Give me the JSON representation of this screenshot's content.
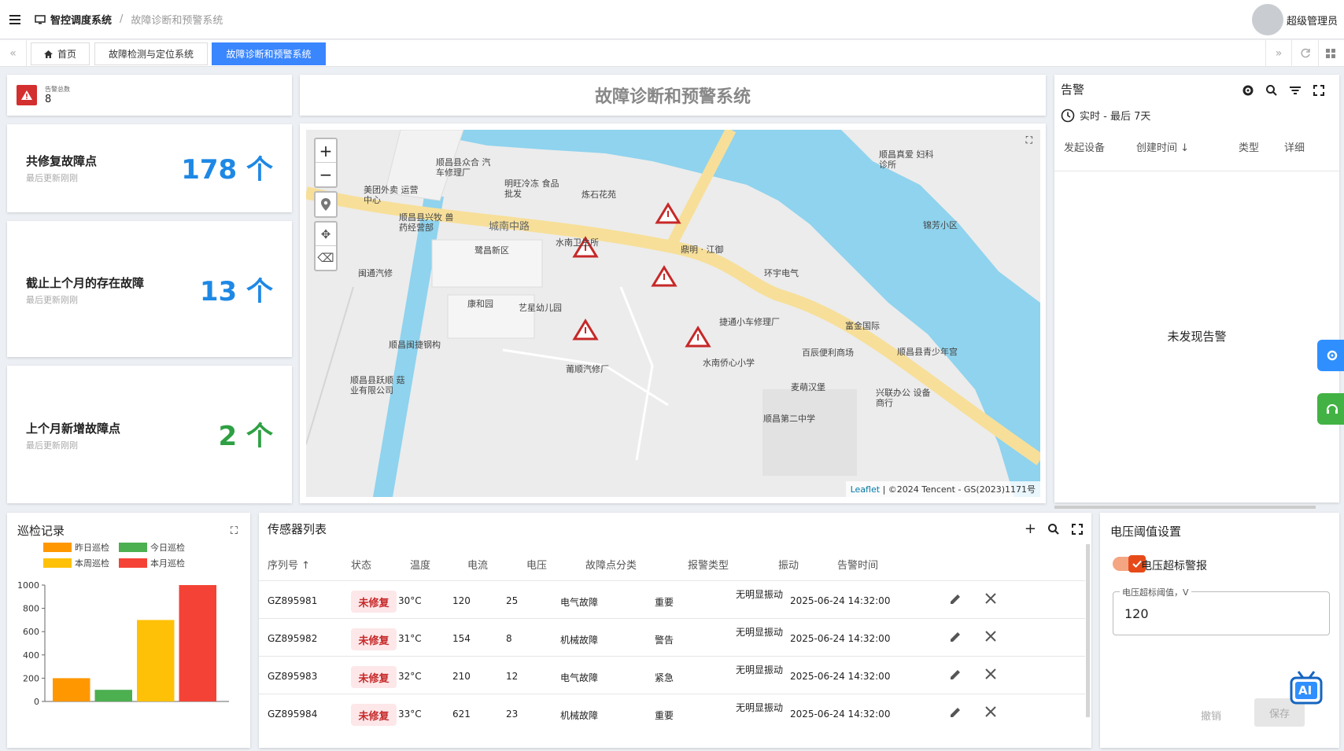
{
  "header": {
    "app_title": "智控调度系统",
    "current_page": "故障诊断和预警系统",
    "user_name": "超级管理员"
  },
  "tabs": [
    {
      "label": "首页"
    },
    {
      "label": "故障检测与定位系统"
    },
    {
      "label": "故障诊断和预警系统"
    }
  ],
  "alarm_total": {
    "label": "告警总数",
    "value": "8"
  },
  "stats": [
    {
      "label": "共修复故障点",
      "sub": "最后更新刚刚",
      "value": "178 个",
      "color": "#1e88e5"
    },
    {
      "label": "截止上个月的存在故障",
      "sub": "最后更新刚刚",
      "value": "13 个",
      "color": "#1e88e5"
    },
    {
      "label": "上个月新增故障点",
      "sub": "最后更新刚刚",
      "value": "2 个",
      "color": "#2ea043"
    }
  ],
  "map": {
    "title": "故障诊断和预警系统",
    "road_label": "城南中路",
    "places": [
      {
        "name": "顺昌县众合 汽车修理厂"
      },
      {
        "name": "明旺冷冻 食品批发"
      },
      {
        "name": "炼石花苑"
      },
      {
        "name": "美团外卖 运营中心"
      },
      {
        "name": "顺昌县兴牧 兽药经营部"
      },
      {
        "name": "水南卫生所"
      },
      {
        "name": "鹭昌新区"
      },
      {
        "name": "闽通汽修"
      },
      {
        "name": "康和园"
      },
      {
        "name": "艺星幼儿园"
      },
      {
        "name": "鼎明 · 江御"
      },
      {
        "name": "环宇电气"
      },
      {
        "name": "捷通小车修理厂"
      },
      {
        "name": "顺昌闽捷钢构"
      },
      {
        "name": "莆顺汽修厂"
      },
      {
        "name": "水南侨心小学"
      },
      {
        "name": "富金国际"
      },
      {
        "name": "百辰便利商场"
      },
      {
        "name": "顺昌县青少年宫"
      },
      {
        "name": "顺昌县跃顺 菇业有限公司"
      },
      {
        "name": "麦萌汉堡"
      },
      {
        "name": "兴联办公 设备商行"
      },
      {
        "name": "顺昌第二中学"
      },
      {
        "name": "顺昌真爱 妇科诊所"
      },
      {
        "name": "锦芳小区"
      }
    ],
    "attribution_link": "Leaflet",
    "attribution_text": "| ©2024 Tencent - GS(2023)1171号"
  },
  "alarm_panel": {
    "title": "告警",
    "time_range": "实时 - 最后 7天",
    "columns": [
      "发起设备",
      "创建时间",
      "类型",
      "详细"
    ],
    "empty_text": "未发现告警"
  },
  "patrol": {
    "title": "巡检记录"
  },
  "chart_data": {
    "type": "bar",
    "categories": [
      "昨日巡检",
      "今日巡检",
      "本周巡检",
      "本月巡检"
    ],
    "series": [
      {
        "name": "昨日巡检",
        "values": [
          200
        ],
        "color": "#ff9800"
      },
      {
        "name": "今日巡检",
        "values": [
          100
        ],
        "color": "#4caf50"
      },
      {
        "name": "本周巡检",
        "values": [
          700
        ],
        "color": "#ffc107"
      },
      {
        "name": "本月巡检",
        "values": [
          1000
        ],
        "color": "#f44336"
      }
    ],
    "yticks": [
      "0",
      "200",
      "400",
      "600",
      "800",
      "1000"
    ],
    "ylim": [
      0,
      1000
    ],
    "legend_position": "top"
  },
  "sensor": {
    "title": "传感器列表",
    "columns": [
      "序列号",
      "状态",
      "温度",
      "电流",
      "电压",
      "故障点分类",
      "报警类型",
      "振动",
      "告警时间"
    ],
    "rows": [
      {
        "serial": "GZ895981",
        "status": "未修复",
        "temp": "30°C",
        "current": "120",
        "voltage": "25",
        "category": "电气故障",
        "alarm": "重要",
        "vibration": "无明显振动",
        "time": "2025-06-24 14:32:00"
      },
      {
        "serial": "GZ895982",
        "status": "未修复",
        "temp": "31°C",
        "current": "154",
        "voltage": "8",
        "category": "机械故障",
        "alarm": "警告",
        "vibration": "无明显振动",
        "time": "2025-06-24 14:32:00"
      },
      {
        "serial": "GZ895983",
        "status": "未修复",
        "temp": "32°C",
        "current": "210",
        "voltage": "12",
        "category": "电气故障",
        "alarm": "紧急",
        "vibration": "无明显振动",
        "time": "2025-06-24 14:32:00"
      },
      {
        "serial": "GZ895984",
        "status": "未修复",
        "temp": "33°C",
        "current": "621",
        "voltage": "23",
        "category": "机械故障",
        "alarm": "重要",
        "vibration": "无明显振动",
        "time": "2025-06-24 14:32:00"
      }
    ]
  },
  "voltage": {
    "title": "电压阈值设置",
    "toggle_label": "电压超标警报",
    "field_label": "电压超标阈值，V",
    "field_value": "120",
    "cancel": "撤销",
    "save": "保存",
    "ai_label": "AI"
  }
}
